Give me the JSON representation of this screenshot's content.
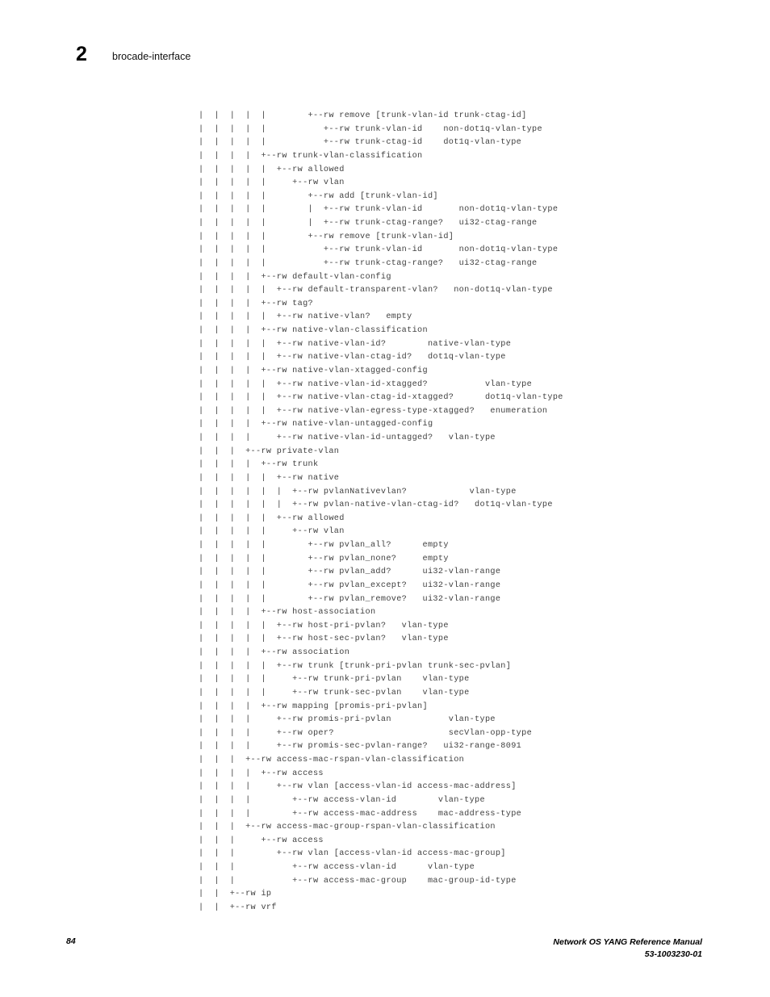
{
  "header": {
    "chapter_number": "2",
    "chapter_title": "brocade-interface"
  },
  "footer": {
    "page_number": "84",
    "manual_title": "Network OS YANG Reference Manual",
    "document_number": "53-1003230-01"
  },
  "colors": {
    "page_background": "#ffffff",
    "tree_text": "#404040",
    "header_text": "#000000",
    "footer_text": "#000000"
  },
  "content": {
    "type": "yang-tree-diagram",
    "lines": [
      "|  |  |  |  |        +--rw remove [trunk-vlan-id trunk-ctag-id]",
      "|  |  |  |  |           +--rw trunk-vlan-id    non-dot1q-vlan-type",
      "|  |  |  |  |           +--rw trunk-ctag-id    dot1q-vlan-type",
      "|  |  |  |  +--rw trunk-vlan-classification",
      "|  |  |  |  |  +--rw allowed",
      "|  |  |  |  |     +--rw vlan",
      "|  |  |  |  |        +--rw add [trunk-vlan-id]",
      "|  |  |  |  |        |  +--rw trunk-vlan-id       non-dot1q-vlan-type",
      "|  |  |  |  |        |  +--rw trunk-ctag-range?   ui32-ctag-range",
      "|  |  |  |  |        +--rw remove [trunk-vlan-id]",
      "|  |  |  |  |           +--rw trunk-vlan-id       non-dot1q-vlan-type",
      "|  |  |  |  |           +--rw trunk-ctag-range?   ui32-ctag-range",
      "|  |  |  |  +--rw default-vlan-config",
      "|  |  |  |  |  +--rw default-transparent-vlan?   non-dot1q-vlan-type",
      "|  |  |  |  +--rw tag?",
      "|  |  |  |  |  +--rw native-vlan?   empty",
      "|  |  |  |  +--rw native-vlan-classification",
      "|  |  |  |  |  +--rw native-vlan-id?        native-vlan-type",
      "|  |  |  |  |  +--rw native-vlan-ctag-id?   dot1q-vlan-type",
      "|  |  |  |  +--rw native-vlan-xtagged-config",
      "|  |  |  |  |  +--rw native-vlan-id-xtagged?           vlan-type",
      "|  |  |  |  |  +--rw native-vlan-ctag-id-xtagged?      dot1q-vlan-type",
      "|  |  |  |  |  +--rw native-vlan-egress-type-xtagged?   enumeration",
      "|  |  |  |  +--rw native-vlan-untagged-config",
      "|  |  |  |     +--rw native-vlan-id-untagged?   vlan-type",
      "|  |  |  +--rw private-vlan",
      "|  |  |  |  +--rw trunk",
      "|  |  |  |  |  +--rw native",
      "|  |  |  |  |  |  +--rw pvlanNativevlan?            vlan-type",
      "|  |  |  |  |  |  +--rw pvlan-native-vlan-ctag-id?   dot1q-vlan-type",
      "|  |  |  |  |  +--rw allowed",
      "|  |  |  |  |     +--rw vlan",
      "|  |  |  |  |        +--rw pvlan_all?      empty",
      "|  |  |  |  |        +--rw pvlan_none?     empty",
      "|  |  |  |  |        +--rw pvlan_add?      ui32-vlan-range",
      "|  |  |  |  |        +--rw pvlan_except?   ui32-vlan-range",
      "|  |  |  |  |        +--rw pvlan_remove?   ui32-vlan-range",
      "|  |  |  |  +--rw host-association",
      "|  |  |  |  |  +--rw host-pri-pvlan?   vlan-type",
      "|  |  |  |  |  +--rw host-sec-pvlan?   vlan-type",
      "|  |  |  |  +--rw association",
      "|  |  |  |  |  +--rw trunk [trunk-pri-pvlan trunk-sec-pvlan]",
      "|  |  |  |  |     +--rw trunk-pri-pvlan    vlan-type",
      "|  |  |  |  |     +--rw trunk-sec-pvlan    vlan-type",
      "|  |  |  |  +--rw mapping [promis-pri-pvlan]",
      "|  |  |  |     +--rw promis-pri-pvlan           vlan-type",
      "|  |  |  |     +--rw oper?                      secVlan-opp-type",
      "|  |  |  |     +--rw promis-sec-pvlan-range?   ui32-range-8091",
      "|  |  |  +--rw access-mac-rspan-vlan-classification",
      "|  |  |  |  +--rw access",
      "|  |  |  |     +--rw vlan [access-vlan-id access-mac-address]",
      "|  |  |  |        +--rw access-vlan-id        vlan-type",
      "|  |  |  |        +--rw access-mac-address    mac-address-type",
      "|  |  |  +--rw access-mac-group-rspan-vlan-classification",
      "|  |  |     +--rw access",
      "|  |  |        +--rw vlan [access-vlan-id access-mac-group]",
      "|  |  |           +--rw access-vlan-id      vlan-type",
      "|  |  |           +--rw access-mac-group    mac-group-id-type",
      "|  |  +--rw ip",
      "|  |  +--rw vrf"
    ]
  }
}
